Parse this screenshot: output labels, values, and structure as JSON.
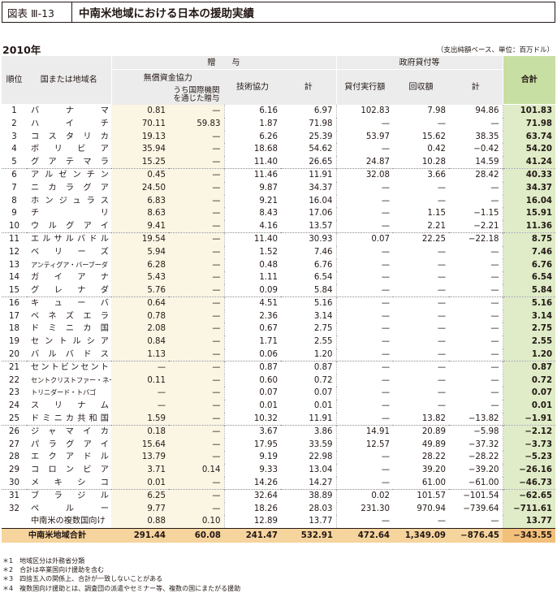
{
  "header": {
    "label": "図表 Ⅲ-13",
    "title": "中南米地域における日本の援助実績"
  },
  "year": "2010年",
  "unit_note": "（支出純額ベース、単位：百万ドル）",
  "columns": {
    "rank": "順位",
    "country": "国または地域名",
    "grant": "贈　　与",
    "grant_aid": "無償資金協力",
    "via_intl": "うち国際機関を通じた贈与",
    "tech": "技術協力",
    "subtotal": "計",
    "loans": "政府貸付等",
    "disbursed": "貸付実行額",
    "recovered": "回収額",
    "loan_subtotal": "計",
    "total": "合計"
  },
  "rows": [
    {
      "rank": "1",
      "name": "バナマ",
      "v": [
        "0.81",
        "—",
        "6.16",
        "6.97",
        "102.83",
        "7.98",
        "94.86",
        "101.83"
      ]
    },
    {
      "rank": "2",
      "name": "ハイチ",
      "v": [
        "70.11",
        "59.83",
        "1.87",
        "71.98",
        "—",
        "—",
        "—",
        "71.98"
      ]
    },
    {
      "rank": "3",
      "name": "コスタリカ",
      "v": [
        "19.13",
        "—",
        "6.26",
        "25.39",
        "53.97",
        "15.62",
        "38.35",
        "63.74"
      ]
    },
    {
      "rank": "4",
      "name": "ボリビア",
      "v": [
        "35.94",
        "—",
        "18.68",
        "54.62",
        "—",
        "0.42",
        "−0.42",
        "54.20"
      ]
    },
    {
      "rank": "5",
      "name": "グアテマラ",
      "v": [
        "15.25",
        "—",
        "11.40",
        "26.65",
        "24.87",
        "10.28",
        "14.59",
        "41.24"
      ]
    },
    {
      "rank": "6",
      "name": "アルゼンチン",
      "v": [
        "0.45",
        "—",
        "11.46",
        "11.91",
        "32.08",
        "3.66",
        "28.42",
        "40.33"
      ]
    },
    {
      "rank": "7",
      "name": "ニカラグア",
      "v": [
        "24.50",
        "—",
        "9.87",
        "34.37",
        "—",
        "—",
        "—",
        "34.37"
      ]
    },
    {
      "rank": "8",
      "name": "ホンジュラス",
      "v": [
        "6.83",
        "—",
        "9.21",
        "16.04",
        "—",
        "—",
        "—",
        "16.04"
      ]
    },
    {
      "rank": "9",
      "name": "チリ",
      "v": [
        "8.63",
        "—",
        "8.43",
        "17.06",
        "—",
        "1.15",
        "−1.15",
        "15.91"
      ]
    },
    {
      "rank": "10",
      "name": "ウルグアイ",
      "v": [
        "9.41",
        "—",
        "4.16",
        "13.57",
        "—",
        "2.21",
        "−2.21",
        "11.36"
      ]
    },
    {
      "rank": "11",
      "name": "エルサルバドル",
      "v": [
        "19.54",
        "—",
        "11.40",
        "30.93",
        "0.07",
        "22.25",
        "−22.18",
        "8.75"
      ]
    },
    {
      "rank": "12",
      "name": "ベリーズ",
      "v": [
        "5.94",
        "—",
        "1.52",
        "7.46",
        "—",
        "—",
        "—",
        "7.46"
      ]
    },
    {
      "rank": "13",
      "name": "アンティグア・バーブーダ",
      "v": [
        "6.28",
        "—",
        "0.48",
        "6.76",
        "—",
        "—",
        "—",
        "6.76"
      ]
    },
    {
      "rank": "14",
      "name": "ガイアナ",
      "v": [
        "5.43",
        "—",
        "1.11",
        "6.54",
        "—",
        "—",
        "—",
        "6.54"
      ]
    },
    {
      "rank": "15",
      "name": "グレナダ",
      "v": [
        "5.76",
        "—",
        "0.09",
        "5.84",
        "—",
        "—",
        "—",
        "5.84"
      ]
    },
    {
      "rank": "16",
      "name": "キューバ",
      "v": [
        "0.64",
        "—",
        "4.51",
        "5.16",
        "—",
        "—",
        "—",
        "5.16"
      ]
    },
    {
      "rank": "17",
      "name": "ベネズエラ",
      "v": [
        "0.78",
        "—",
        "2.36",
        "3.14",
        "—",
        "—",
        "—",
        "3.14"
      ]
    },
    {
      "rank": "18",
      "name": "ドミニカ国",
      "v": [
        "2.08",
        "—",
        "0.67",
        "2.75",
        "—",
        "—",
        "—",
        "2.75"
      ]
    },
    {
      "rank": "19",
      "name": "セントルシア",
      "v": [
        "0.84",
        "—",
        "1.71",
        "2.55",
        "—",
        "—",
        "—",
        "2.55"
      ]
    },
    {
      "rank": "20",
      "name": "バルバドス",
      "v": [
        "1.13",
        "—",
        "0.06",
        "1.20",
        "—",
        "—",
        "—",
        "1.20"
      ]
    },
    {
      "rank": "21",
      "name": "セントビンセント",
      "v": [
        "—",
        "—",
        "0.87",
        "0.87",
        "—",
        "—",
        "—",
        "0.87"
      ]
    },
    {
      "rank": "22",
      "name": "セントクリストファー・ネーヴィス",
      "v": [
        "0.11",
        "—",
        "0.60",
        "0.72",
        "—",
        "—",
        "—",
        "0.72"
      ]
    },
    {
      "rank": "23",
      "name": "トリニダード・トバゴ",
      "v": [
        "—",
        "—",
        "0.07",
        "0.07",
        "—",
        "—",
        "—",
        "0.07"
      ]
    },
    {
      "rank": "24",
      "name": "スリナム",
      "v": [
        "—",
        "—",
        "0.01",
        "0.01",
        "—",
        "—",
        "—",
        "0.01"
      ]
    },
    {
      "rank": "25",
      "name": "ドミニカ共和国",
      "v": [
        "1.59",
        "—",
        "10.32",
        "11.91",
        "—",
        "13.82",
        "−13.82",
        "−1.91"
      ]
    },
    {
      "rank": "26",
      "name": "ジャマイカ",
      "v": [
        "0.18",
        "—",
        "3.67",
        "3.86",
        "14.91",
        "20.89",
        "−5.98",
        "−2.12"
      ]
    },
    {
      "rank": "27",
      "name": "パラグアイ",
      "v": [
        "15.64",
        "—",
        "17.95",
        "33.59",
        "12.57",
        "49.89",
        "−37.32",
        "−3.73"
      ]
    },
    {
      "rank": "28",
      "name": "エクアドル",
      "v": [
        "13.79",
        "—",
        "9.19",
        "22.98",
        "—",
        "28.22",
        "−28.22",
        "−5.23"
      ]
    },
    {
      "rank": "29",
      "name": "コロンビア",
      "v": [
        "3.71",
        "0.14",
        "9.33",
        "13.04",
        "—",
        "39.20",
        "−39.20",
        "−26.16"
      ]
    },
    {
      "rank": "30",
      "name": "メキシコ",
      "v": [
        "0.01",
        "—",
        "14.26",
        "14.27",
        "—",
        "61.00",
        "−61.00",
        "−46.73"
      ]
    },
    {
      "rank": "31",
      "name": "ブラジル",
      "v": [
        "6.25",
        "—",
        "32.64",
        "38.89",
        "0.02",
        "101.57",
        "−101.54",
        "−62.65"
      ]
    },
    {
      "rank": "32",
      "name": "ペルー",
      "v": [
        "9.77",
        "—",
        "18.26",
        "28.03",
        "231.30",
        "970.94",
        "−739.64",
        "−711.61"
      ]
    },
    {
      "rank": "",
      "name": "中南米の複数国向け",
      "v": [
        "0.88",
        "0.10",
        "12.89",
        "13.77",
        "—",
        "—",
        "—",
        "13.77"
      ]
    }
  ],
  "summary": {
    "name": "中南米地域合計",
    "v": [
      "291.44",
      "60.08",
      "241.47",
      "532.91",
      "472.64",
      "1,349.09",
      "−876.45",
      "−343.55"
    ]
  },
  "notes": [
    "＊1　地域区分は外務省分類",
    "＊2　合計は卒業国向け援助を含む",
    "＊3　四捨五入の関係上、合計が一致しないことがある",
    "＊4　複数国向け援助とは、調査団の派遣やセミナー等、複数の国にまたがる援助"
  ]
}
